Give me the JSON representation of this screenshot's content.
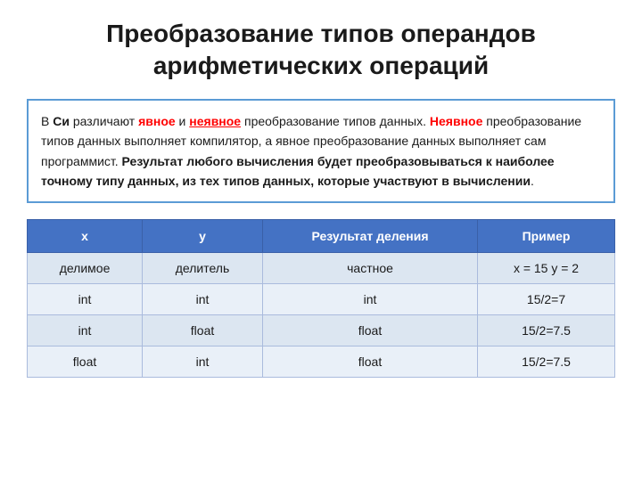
{
  "title": "Преобразование типов операндов арифметических операций",
  "infoBox": {
    "part1": "В ",
    "си": "Си",
    "part2": " различают ",
    "явное": "явное",
    "part3": " и ",
    "неявное": "неявное",
    "part4": " преобразование типов данных. ",
    "неявное2": "Неявное",
    "part5": " преобразование типов данных выполняет компилятор, а явное преобразование данных выполняет сам программист. ",
    "bold1": "Результат любого вычисления будет преобразовываться к наиболее точному типу данных, из тех типов данных, которые участвуют в вычислении",
    "part6": "."
  },
  "table": {
    "headers": [
      "x",
      "y",
      "Результат деления",
      "Пример"
    ],
    "rows": [
      [
        "делимое",
        "делитель",
        "частное",
        "x = 15 y = 2"
      ],
      [
        "int",
        "int",
        "int",
        "15/2=7"
      ],
      [
        "int",
        "float",
        "float",
        "15/2=7.5"
      ],
      [
        "float",
        "int",
        "float",
        "15/2=7.5"
      ]
    ]
  }
}
